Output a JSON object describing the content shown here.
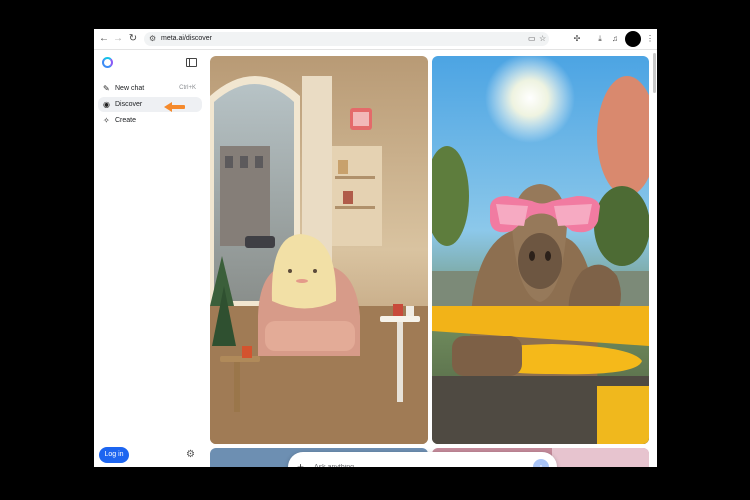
{
  "browser": {
    "back_icon": "arrow-left-icon",
    "forward_icon": "arrow-right-icon",
    "reload_icon": "reload-icon",
    "url": "meta.ai/discover",
    "toolbar_icons": [
      "cast-icon",
      "star-icon",
      "extensions-icon",
      "download-icon",
      "media-icon",
      "profile-icon",
      "menu-icon"
    ]
  },
  "sidebar": {
    "logo": "meta-ai-logo",
    "toggle_icon": "sidebar-toggle-icon",
    "items": [
      {
        "label": "New chat",
        "shortcut": "Ctrl+K",
        "icon": "compose-icon"
      },
      {
        "label": "Discover",
        "shortcut": "",
        "icon": "compass-icon",
        "active": true
      },
      {
        "label": "Create",
        "shortcut": "",
        "icon": "sparkle-brush-icon"
      }
    ],
    "login_label": "Log in",
    "settings_icon": "gear-icon"
  },
  "annotation": {
    "arrow_color": "#f58a2c"
  },
  "feed": {
    "cards": [
      {
        "alt": "Cartoon character sitting in pink armchair by arched window"
      },
      {
        "alt": "Capybara wearing pink sunglasses driving a yellow car"
      }
    ]
  },
  "composer": {
    "placeholder": "Ask anything...",
    "add_icon": "plus-icon",
    "send_icon": "arrow-up-icon"
  },
  "colors": {
    "accent": "#1d65f0",
    "send_button": "#a9c4f6"
  }
}
